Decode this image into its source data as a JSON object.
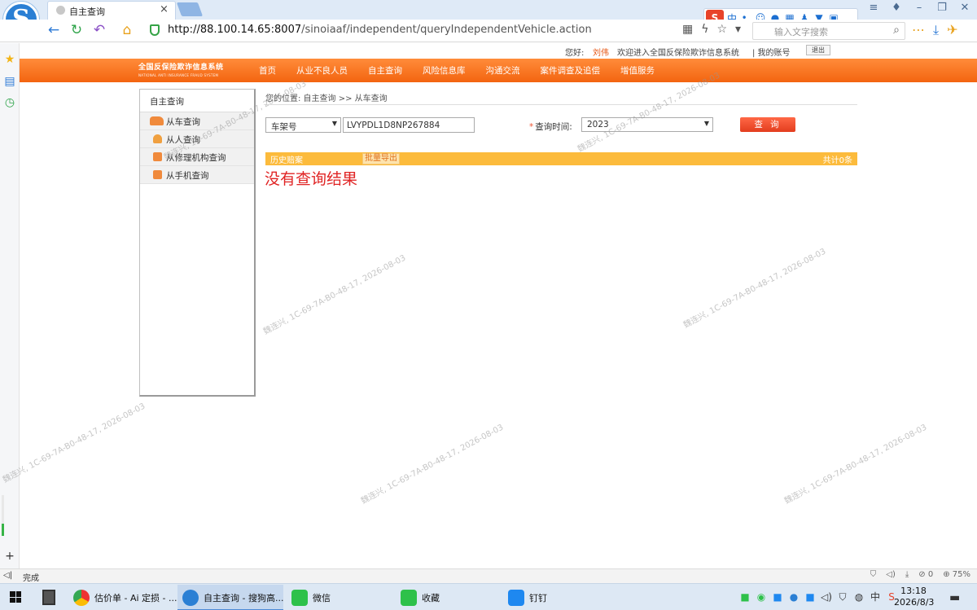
{
  "browser": {
    "logo_letter": "S",
    "tab_title": "自主查询",
    "tab_close": "×",
    "url_host": "http://88.100.14.65:8007",
    "url_path": "/sinoiaaf/independent/queryIndependentVehicle.action",
    "search_placeholder": "输入文字搜索",
    "ime_label": "中",
    "status_text": "完成",
    "zoom": "75%",
    "blocked_count": "0"
  },
  "header": {
    "greeting": "您好:",
    "user_name": "刘伟",
    "welcome": "欢迎进入全国反保险欺诈信息系统",
    "account": "| 我的账号",
    "logout": "退出"
  },
  "site": {
    "logo_cn": "全国反保险欺诈信息系统",
    "logo_en": "NATIONAL ANTI INSURANCE FRAUD SYSTEM",
    "nav": [
      "首页",
      "从业不良人员",
      "自主查询",
      "风险信息库",
      "沟通交流",
      "案件调查及追偿",
      "增值服务"
    ]
  },
  "sidebar": {
    "title": "自主查询",
    "items": [
      {
        "label": "从车查询"
      },
      {
        "label": "从人查询"
      },
      {
        "label": "从修理机构查询"
      },
      {
        "label": "从手机查询"
      }
    ]
  },
  "breadcrumb": "您的位置: 自主查询 >> 从车查询",
  "query": {
    "type_selected": "车架号",
    "vin_value": "LVYPDL1D8NP267884",
    "time_label": "查询时间:",
    "time_required": "*",
    "year_selected": "2023",
    "submit_label": "查 询"
  },
  "results": {
    "history_label": "历史赔案",
    "export_label": "批量导出",
    "total_label": "共计0条",
    "empty_message": "没有查询结果"
  },
  "watermark_text": "魏连兴, 1C-69-7A-B0-48-17, 2026-08-03",
  "taskbar": {
    "apps": [
      {
        "label": "估价单 - Ai 定损 - ..."
      },
      {
        "label": "自主查询 - 搜狗高..."
      },
      {
        "label": "微信"
      },
      {
        "label": "收藏"
      },
      {
        "label": "钉钉"
      }
    ],
    "time": "13:18",
    "date": "2026/8/3",
    "ime_indicator": "中"
  },
  "colors": {
    "nav_orange": "#f36410",
    "result_bar": "#fcbb3c",
    "empty_red": "#e02424",
    "user_name": "#e65410"
  }
}
